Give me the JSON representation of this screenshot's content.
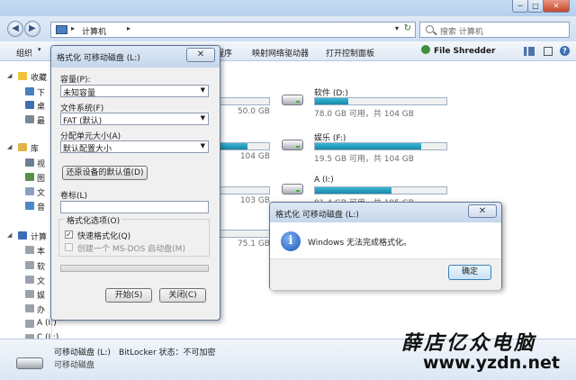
{
  "explorer": {
    "address": {
      "path": "计算机",
      "sep": "▸"
    },
    "search_placeholder": "搜索 计算机",
    "window_buttons": {
      "min": "─",
      "max": "□",
      "close": "✕"
    },
    "toolbar": {
      "organize": "组织",
      "system_props": "程序",
      "map_drive": "映射网络驱动器",
      "open_panel": "打开控制面板",
      "file_shredder": "File Shredder",
      "help": "?"
    },
    "sidebar": {
      "items": [
        {
          "label": "收藏",
          "level": "top",
          "icon": "star-icon"
        },
        {
          "label": "下",
          "level": "sub",
          "icon": "download-icon"
        },
        {
          "label": "桌",
          "level": "sub",
          "icon": "desktop-icon"
        },
        {
          "label": "最",
          "level": "sub",
          "icon": "recent-icon"
        },
        {
          "label": "库",
          "level": "top",
          "icon": "library-icon"
        },
        {
          "label": "视",
          "level": "sub",
          "icon": "video-icon"
        },
        {
          "label": "图",
          "level": "sub",
          "icon": "picture-icon"
        },
        {
          "label": "文",
          "level": "sub",
          "icon": "document-icon"
        },
        {
          "label": "音",
          "level": "sub",
          "icon": "music-icon"
        },
        {
          "label": "计算",
          "level": "top",
          "icon": "computer-icon"
        },
        {
          "label": "本",
          "level": "sub",
          "icon": "drive-icon"
        },
        {
          "label": "软",
          "level": "sub",
          "icon": "drive-icon"
        },
        {
          "label": "文",
          "level": "sub",
          "icon": "drive-icon"
        },
        {
          "label": "娱",
          "level": "sub",
          "icon": "drive-icon"
        },
        {
          "label": "办",
          "level": "sub",
          "icon": "drive-icon"
        },
        {
          "label": "A (I:)",
          "level": "sub",
          "icon": "drive-icon"
        },
        {
          "label": "C (L:)",
          "level": "sub",
          "icon": "drive-icon"
        }
      ]
    },
    "drives": [
      {
        "name": "",
        "free": "50.0 GB",
        "used_fraction": 0.5
      },
      {
        "name": "软件 (D:)",
        "free": "78.0 GB 可用，共 104 GB",
        "used_fraction": 0.25
      },
      {
        "name": "",
        "free": "104 GB",
        "used_fraction": 0.8
      },
      {
        "name": "娱乐 (F:)",
        "free": "19.5 GB 可用，共 104 GB",
        "used_fraction": 0.81
      },
      {
        "name": "",
        "free": "103 GB",
        "used_fraction": 0.45
      },
      {
        "name": "A (I:)",
        "free": "81.4 GB 可用，共 195 GB",
        "used_fraction": 0.58
      },
      {
        "name": "",
        "free": "75.1 GB",
        "used_fraction": 0.0
      }
    ],
    "status": {
      "name": "可移动磁盘 (L:)",
      "bitlocker": "BitLocker 状态：不可加密",
      "type": "可移动磁盘"
    }
  },
  "format_dialog": {
    "title": "格式化 可移动磁盘 (L:)",
    "close": "✕",
    "capacity_label": "容量(P):",
    "capacity_value": "未知容量",
    "fs_label": "文件系统(F)",
    "fs_value": "FAT (默认)",
    "alloc_label": "分配单元大小(A)",
    "alloc_value": "默认配置大小",
    "restore_button": "还原设备的默认值(D)",
    "volume_label": "卷标(L)",
    "volume_value": "",
    "options_title": "格式化选项(O)",
    "quick_format": "快速格式化(Q)",
    "quick_format_checked": true,
    "msdos_boot": "创建一个 MS-DOS 启动盘(M)",
    "msdos_boot_checked": false,
    "start_button": "开始(S)",
    "close_button": "关闭(C)"
  },
  "message_box": {
    "title": "格式化 可移动磁盘 (L:)",
    "close": "✕",
    "icon": "info-icon",
    "text": "Windows 无法完成格式化。",
    "ok": "确定"
  },
  "watermark": {
    "name": "薛店亿众电脑",
    "url": "www.yzdn.net"
  }
}
